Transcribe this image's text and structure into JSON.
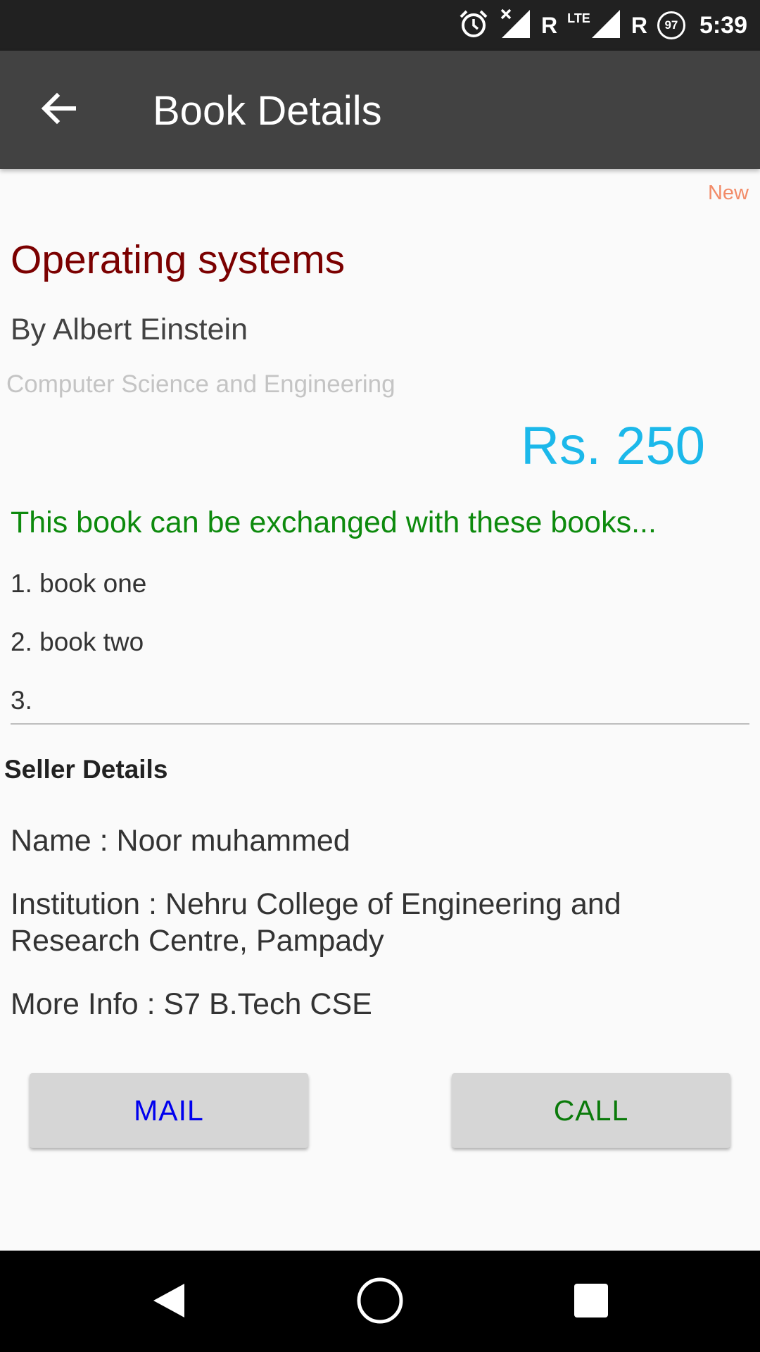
{
  "status_bar": {
    "alarm_icon": "alarm-clock-icon",
    "signal_letter_1": "R",
    "lte_label": "LTE",
    "signal_letter_2": "R",
    "battery_level": "97",
    "time": "5:39"
  },
  "app_bar": {
    "title": "Book Details",
    "back_icon": "arrow-back-icon",
    "background_color": "#424242"
  },
  "book": {
    "condition": "New",
    "title": "Operating systems",
    "author": "By Albert Einstein",
    "category": "Computer Science and Engineering",
    "price": "Rs. 250"
  },
  "exchange": {
    "heading": "This book can be exchanged with these books...",
    "items": [
      "1. book one",
      "2. book two",
      "3."
    ]
  },
  "seller": {
    "heading": "Seller Details",
    "name": "Name : Noor muhammed",
    "institution": "Institution : Nehru College of Engineering and Research Centre, Pampady",
    "more_info": "More Info : S7 B.Tech CSE"
  },
  "actions": {
    "mail_label": "MAIL",
    "call_label": "CALL"
  },
  "colors": {
    "title": "#7b0000",
    "price": "#1cb8ea",
    "exchange_heading": "#0d8a0d",
    "condition": "#f28b68",
    "mail": "#0000ee",
    "call": "#0a7a0a"
  }
}
